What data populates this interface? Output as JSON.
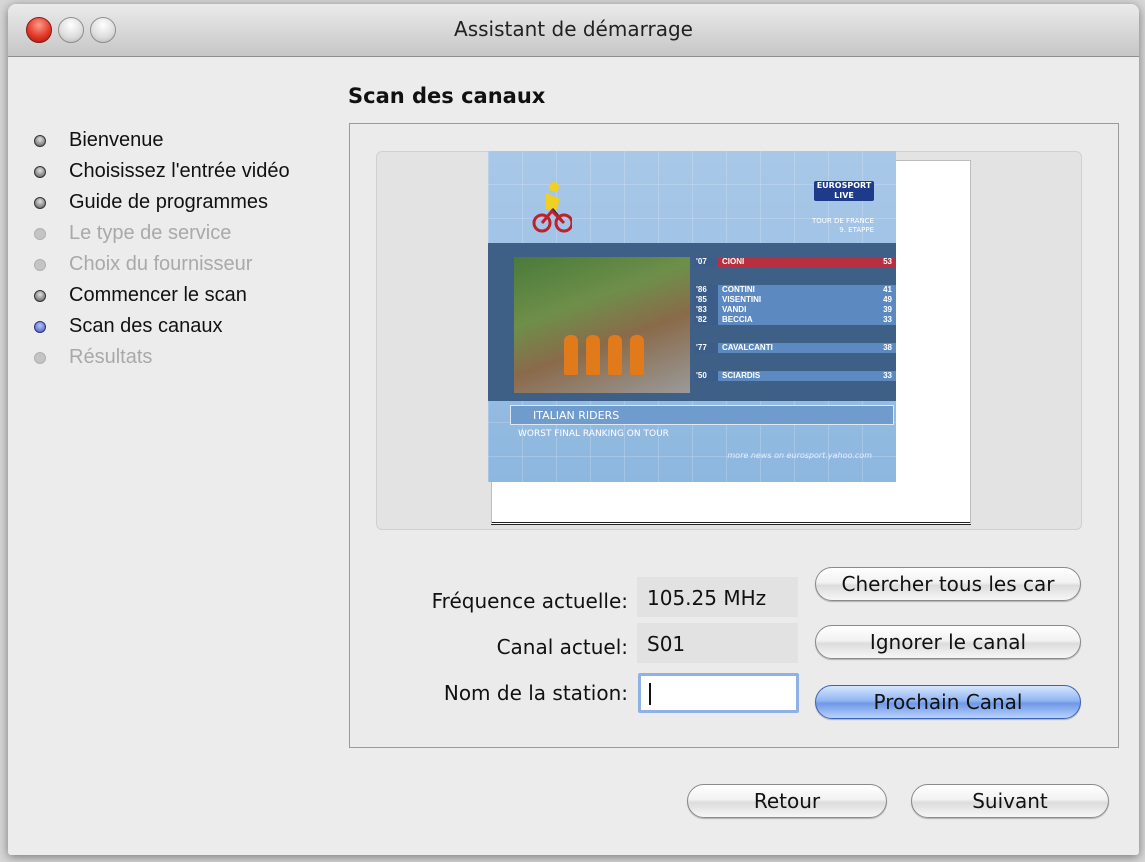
{
  "window": {
    "title": "Assistant de démarrage"
  },
  "sidebar": {
    "steps": [
      {
        "label": "Bienvenue",
        "state": "done"
      },
      {
        "label": "Choisissez l'entrée vidéo",
        "state": "done"
      },
      {
        "label": "Guide de programmes",
        "state": "done"
      },
      {
        "label": "Le type de service",
        "state": "future"
      },
      {
        "label": "Choix du fournisseur",
        "state": "future"
      },
      {
        "label": "Commencer le scan",
        "state": "done"
      },
      {
        "label": "Scan des canaux",
        "state": "current"
      },
      {
        "label": "Résultats",
        "state": "future"
      }
    ]
  },
  "main": {
    "title": "Scan des canaux",
    "preview": {
      "logo": "EUROSPORT LIVE",
      "logo_sub": "TOUR DE FRANCE\n9. ETAPPE",
      "ranking": [
        {
          "pos": "'07",
          "name": "CIONI",
          "val": "53",
          "highlight": true
        },
        {
          "pos": "'86",
          "name": "CONTINI",
          "val": "41"
        },
        {
          "pos": "'85",
          "name": "VISENTINI",
          "val": "49"
        },
        {
          "pos": "'83",
          "name": "VANDI",
          "val": "39"
        },
        {
          "pos": "'82",
          "name": "BECCIA",
          "val": "33"
        },
        {
          "pos": "'77",
          "name": "CAVALCANTI",
          "val": "38"
        },
        {
          "pos": "'50",
          "name": "SCIARDIS",
          "val": "33"
        }
      ],
      "ticker": "ITALIAN RIDERS",
      "subticker": "WORST FINAL RANKING ON TOUR",
      "footer": "more news on eurosport.yahoo.com"
    },
    "fields": {
      "frequency_label": "Fréquence actuelle:",
      "frequency_value": "105.25 MHz",
      "channel_label": "Canal actuel:",
      "channel_value": "S01",
      "station_label": "Nom de la station:",
      "station_value": ""
    },
    "buttons": {
      "scan_all": "Chercher tous les car",
      "skip": "Ignorer le canal",
      "next_channel": "Prochain Canal"
    }
  },
  "footer": {
    "back": "Retour",
    "next": "Suivant"
  }
}
